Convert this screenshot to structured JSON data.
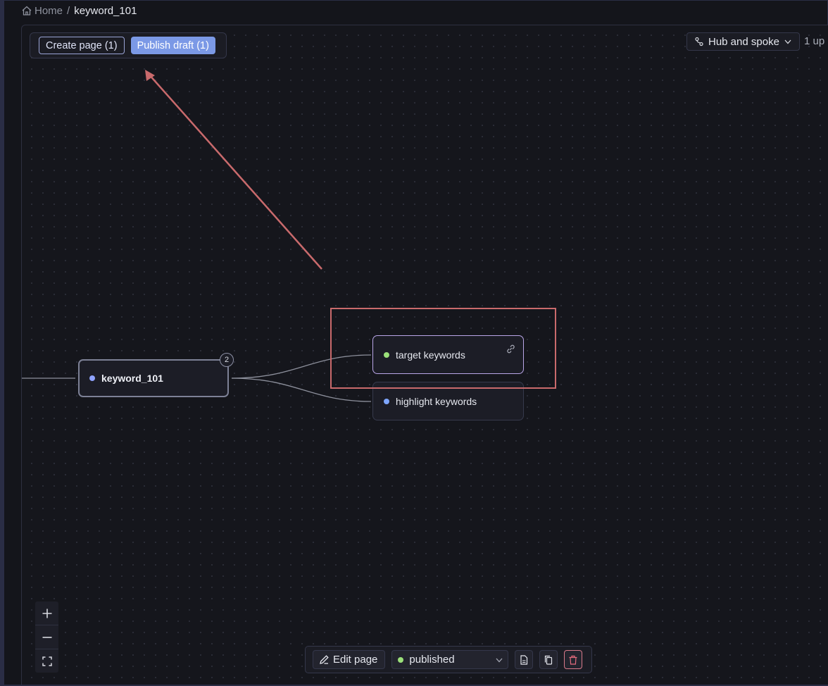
{
  "breadcrumb": {
    "home_label": "Home",
    "separator": "/",
    "current": "keyword_101"
  },
  "toolbar": {
    "create_page_label": "Create page (1)",
    "publish_draft_label": "Publish draft (1)"
  },
  "layout": {
    "selected": "Hub and spoke"
  },
  "stats": {
    "up_text": "1 up ·"
  },
  "graph": {
    "root": {
      "label": "keyword_101",
      "children_count": "2",
      "dot_color": "#8fa3ff"
    },
    "children": [
      {
        "label": "target keywords",
        "dot_color": "#9be07a",
        "selected": true
      },
      {
        "label": "highlight keywords",
        "dot_color": "#7ea6ff",
        "selected": false
      }
    ]
  },
  "bottom_bar": {
    "edit_label": "Edit page",
    "status": "published",
    "status_dot_color": "#9be07a"
  },
  "colors": {
    "accent": "#7b99e6",
    "annotation": "#c96a6c",
    "danger": "#e56b7d"
  }
}
